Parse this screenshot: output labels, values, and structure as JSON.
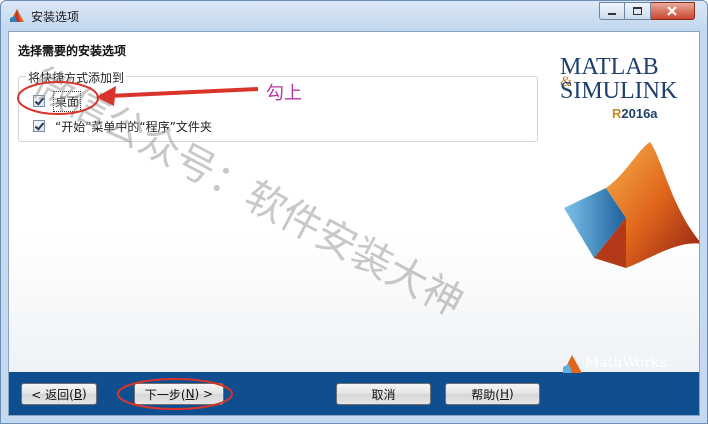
{
  "window": {
    "title": "安装选项"
  },
  "section": {
    "title": "选择需要的安装选项"
  },
  "shortcuts": {
    "group_label": "将快捷方式添加到",
    "options": [
      {
        "label": "桌面",
        "checked": true
      },
      {
        "label": "“开始”菜单中的“程序”文件夹",
        "checked": true
      }
    ]
  },
  "buttons": {
    "back": {
      "text": "< 返回(",
      "key": "B",
      "suffix": ")"
    },
    "next": {
      "text": "下一步(",
      "key": "N",
      "suffix": ") >"
    },
    "cancel": {
      "text": "取消"
    },
    "help": {
      "text": "帮助(",
      "key": "H",
      "suffix": ")"
    }
  },
  "branding": {
    "matlab_line1": "MATLAB",
    "matlab_line2": "SIMULINK",
    "ampersand": "&",
    "release_prefix": "R",
    "release_rest": "2016a",
    "mathworks": "MathWorks"
  },
  "annotation": {
    "text": "勾上",
    "color": "#b43aa0"
  },
  "watermark": {
    "text": "微信公众号：软件安装大神"
  },
  "colors": {
    "bottom_bar": "#0f4f8f",
    "annotation_red": "#d9342b"
  }
}
